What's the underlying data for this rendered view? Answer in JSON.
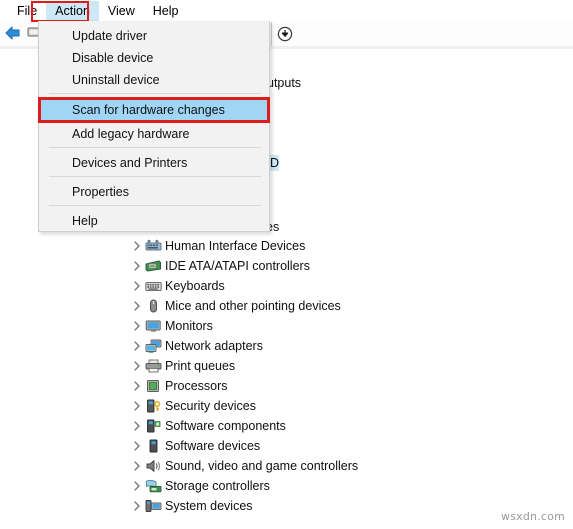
{
  "menubar": {
    "items": [
      {
        "label": "File",
        "active": false
      },
      {
        "label": "Action",
        "active": true
      },
      {
        "label": "View",
        "active": false
      },
      {
        "label": "Help",
        "active": false
      }
    ]
  },
  "toolbar": {
    "back_icon": "back-arrow-icon",
    "properties_icon": "monitor-icon",
    "scan_icon": "download-arrow-icon"
  },
  "dropdown": {
    "items": [
      {
        "label": "Update driver",
        "highlight": false,
        "sep_after": false
      },
      {
        "label": "Disable device",
        "highlight": false,
        "sep_after": false
      },
      {
        "label": "Uninstall device",
        "highlight": false,
        "sep_after": true
      },
      {
        "label": "Scan for hardware changes",
        "highlight": true,
        "sep_after": false
      },
      {
        "label": "Add legacy hardware",
        "highlight": false,
        "sep_after": true
      },
      {
        "label": "Devices and Printers",
        "highlight": false,
        "sep_after": true
      },
      {
        "label": "Properties",
        "highlight": false,
        "sep_after": true
      },
      {
        "label": "Help",
        "highlight": false,
        "sep_after": false
      }
    ]
  },
  "tree": {
    "obscured": [
      {
        "text": "utputs",
        "selected": false
      },
      {
        "text": "HD",
        "selected": true
      },
      {
        "text": "es",
        "selected": false
      }
    ],
    "items": [
      {
        "label": "Human Interface Devices",
        "icon": "hid-icon"
      },
      {
        "label": "IDE ATA/ATAPI controllers",
        "icon": "ide-controller-icon"
      },
      {
        "label": "Keyboards",
        "icon": "keyboard-icon"
      },
      {
        "label": "Mice and other pointing devices",
        "icon": "mouse-icon"
      },
      {
        "label": "Monitors",
        "icon": "monitor-icon"
      },
      {
        "label": "Network adapters",
        "icon": "network-adapter-icon"
      },
      {
        "label": "Print queues",
        "icon": "printer-icon"
      },
      {
        "label": "Processors",
        "icon": "processor-icon"
      },
      {
        "label": "Security devices",
        "icon": "security-device-icon"
      },
      {
        "label": "Software components",
        "icon": "software-component-icon"
      },
      {
        "label": "Software devices",
        "icon": "software-device-icon"
      },
      {
        "label": "Sound, video and game controllers",
        "icon": "speaker-icon"
      },
      {
        "label": "Storage controllers",
        "icon": "storage-controller-icon"
      },
      {
        "label": "System devices",
        "icon": "system-device-icon"
      }
    ]
  },
  "watermark": {
    "text": "wsxdn.com"
  },
  "colors": {
    "highlight_blue": "#9fd5f5",
    "selection_blue": "#cde8f7",
    "annotation_red": "#e01b1b",
    "menu_bg": "#f2f2f2"
  }
}
